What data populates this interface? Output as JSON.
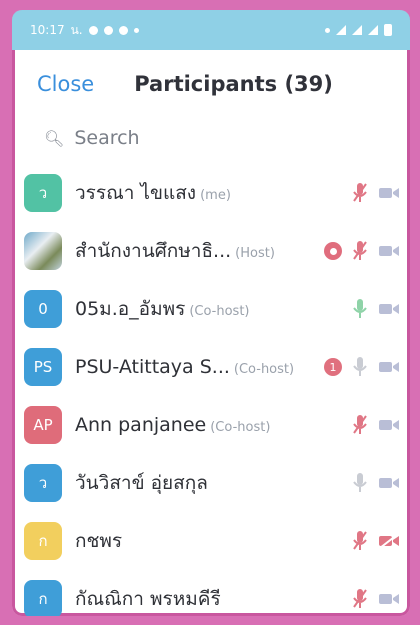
{
  "status_bar": {
    "time": "10:17",
    "carrier": "น."
  },
  "header": {
    "close_label": "Close",
    "title": "Participants (39)"
  },
  "search": {
    "placeholder": "Search"
  },
  "colors": {
    "accent": "#3a8fdc",
    "mic_muted": "#e07685",
    "mic_on": "#8fd3a8",
    "video_off": "#b9bed6"
  },
  "participants": [
    {
      "initial": "ว",
      "avatar_color": "#52c2a4",
      "name": "วรรณา  ไขแสง",
      "role": "(me)",
      "mic": "muted-mic-icon",
      "video": "video-icon"
    },
    {
      "initial": "",
      "avatar_color": "photo",
      "name": "สำนักงานศึกษาธิ...",
      "role": "(Host)",
      "recording": "record-icon",
      "mic": "muted-mic-icon",
      "video": "video-icon"
    },
    {
      "initial": "0",
      "avatar_color": "#3f9ed8",
      "name": "05ม.อ_อัมพร",
      "role": "(Co-host)",
      "mic": "mic-icon",
      "video": "video-icon"
    },
    {
      "initial": "PS",
      "avatar_color": "#3f9ed8",
      "name": "PSU-Atittaya S...",
      "role": "(Co-host)",
      "badge": "1",
      "mic": "mic-icon-gray",
      "video": "video-icon"
    },
    {
      "initial": "AP",
      "avatar_color": "#df6c7a",
      "name": "Ann panjanee",
      "role": "(Co-host)",
      "mic": "muted-mic-icon",
      "video": "video-icon"
    },
    {
      "initial": "ว",
      "avatar_color": "#3f9ed8",
      "name": "วันวิสาข์  อุ่ยสกุล",
      "role": "",
      "mic": "mic-icon-gray",
      "video": "video-icon"
    },
    {
      "initial": "ก",
      "avatar_color": "#f2cf5e",
      "name": "กชพร",
      "role": "",
      "mic": "muted-mic-icon",
      "video": "video-off-icon"
    },
    {
      "initial": "ก",
      "avatar_color": "#3f9ed8",
      "name": "กัณณิกา พรหมคีรี",
      "role": "",
      "mic": "muted-mic-icon",
      "video": "video-icon"
    }
  ]
}
